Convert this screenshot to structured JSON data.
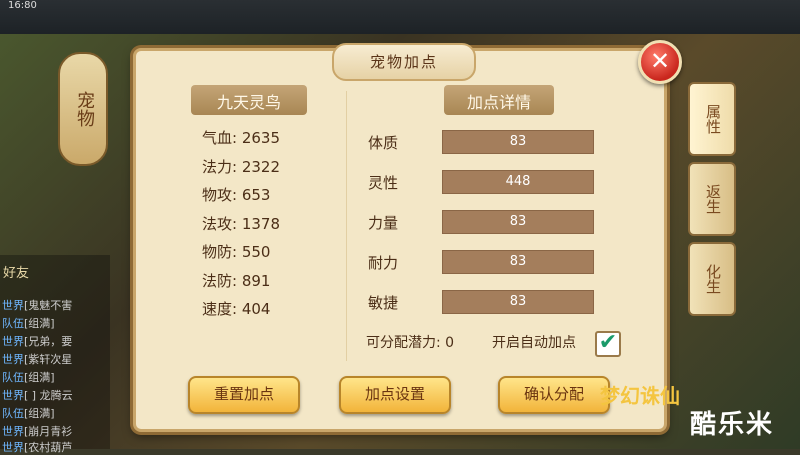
{
  "status": {
    "time": "16:80"
  },
  "side_tab": {
    "label": "宠物"
  },
  "right_tabs": [
    {
      "label": "属性"
    },
    {
      "label": "返生"
    },
    {
      "label": "化生"
    }
  ],
  "chat": {
    "friend_label": "好友",
    "lines": [
      {
        "tag": "世界",
        "text": "[鬼魅不害"
      },
      {
        "tag": "队伍",
        "text": "[组满]"
      },
      {
        "tag": "世界",
        "text": "[兄弟，要"
      },
      {
        "tag": "世界",
        "text": "[紫轩次星"
      },
      {
        "tag": "队伍",
        "text": "[组满]"
      },
      {
        "tag": "世界",
        "text": "[ ] 龙腾云"
      },
      {
        "tag": "队伍",
        "text": "[组满]"
      },
      {
        "tag": "世界",
        "text": "[崩月青衫"
      },
      {
        "tag": "世界",
        "text": "[农村葫芦"
      }
    ]
  },
  "dialog": {
    "title": "宠物加点",
    "close_symbol": "✕",
    "pet_name": "九天灵鸟",
    "stats": [
      {
        "label": "气血:",
        "value": "2635"
      },
      {
        "label": "法力:",
        "value": "2322"
      },
      {
        "label": "物攻:",
        "value": "653"
      },
      {
        "label": "法攻:",
        "value": "1378"
      },
      {
        "label": "物防:",
        "value": "550"
      },
      {
        "label": "法防:",
        "value": "891"
      },
      {
        "label": "速度:",
        "value": "404"
      }
    ],
    "detail_title": "加点详情",
    "attributes": [
      {
        "label": "体质",
        "value": "83"
      },
      {
        "label": "灵性",
        "value": "448"
      },
      {
        "label": "力量",
        "value": "83"
      },
      {
        "label": "耐力",
        "value": "83"
      },
      {
        "label": "敏捷",
        "value": "83"
      }
    ],
    "potential_label": "可分配潜力:",
    "potential_value": "0",
    "auto_label": "开启自动加点",
    "auto_checked": true,
    "buttons": {
      "reset": "重置加点",
      "settings": "加点设置",
      "confirm": "确认分配"
    }
  },
  "branding": {
    "logo": "梦幻诛仙",
    "watermark": "酷乐米"
  },
  "colors": {
    "dialog_bg": "#f3e7c7",
    "bar": "#a47e5c",
    "button": "#f2b43a",
    "close": "#c9261d"
  }
}
